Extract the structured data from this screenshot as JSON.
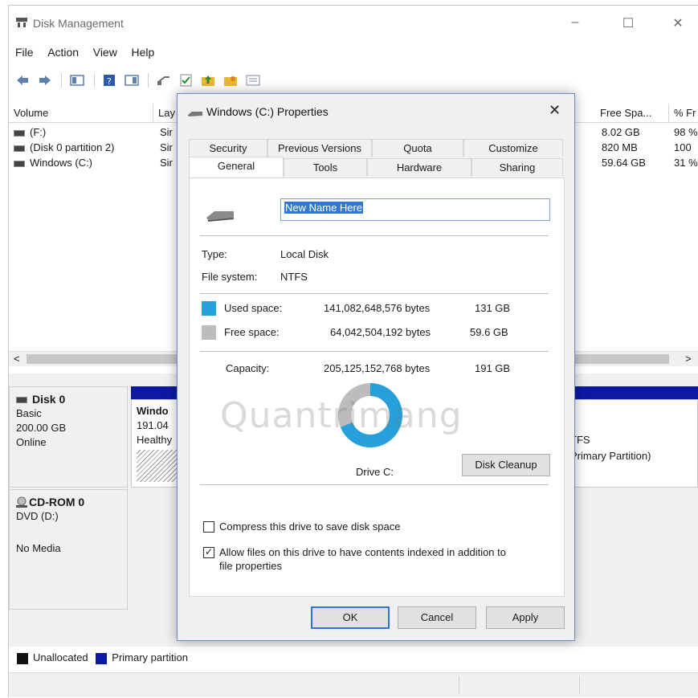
{
  "main": {
    "title": "Disk Management",
    "window_controls": {
      "minimize": "–",
      "maximize": "☐",
      "close": "✕"
    },
    "menu": [
      "File",
      "Action",
      "View",
      "Help"
    ],
    "columns": [
      "Volume",
      "Lay",
      "Free Spa...",
      "% Fr"
    ],
    "volumes": [
      {
        "name": "(F:)",
        "layout": "Sir",
        "free": "8.02 GB",
        "pct": "98 %"
      },
      {
        "name": "(Disk 0 partition 2)",
        "layout": "Sir",
        "free": "820 MB",
        "pct": "100"
      },
      {
        "name": "Windows (C:)",
        "layout": "Sir",
        "free": "59.64 GB",
        "pct": "31 %"
      }
    ],
    "scroll_left": "<",
    "scroll_right": ">",
    "disk0": {
      "name": "Disk 0",
      "type": "Basic",
      "size": "200.00 GB",
      "status": "Online"
    },
    "partition": {
      "name": "Windo",
      "size": "191.04",
      "health": "Healthy",
      "fs": "TFS",
      "kind": "Primary Partition)"
    },
    "cdrom": {
      "name": "CD-ROM 0",
      "drive": "DVD (D:)",
      "media": "No Media"
    },
    "legend": {
      "unallocated": "Unallocated",
      "primary": "Primary partition"
    },
    "colors": {
      "primary": "#0b1aa1",
      "unallocated": "#111111"
    }
  },
  "dialog": {
    "title": "Windows (C:) Properties",
    "close": "✕",
    "tabs_back": [
      "Security",
      "Previous Versions",
      "Quota",
      "Customize"
    ],
    "tabs_front": [
      "General",
      "Tools",
      "Hardware",
      "Sharing"
    ],
    "active_tab": "General",
    "name_value": "New Name Here",
    "type_label": "Type:",
    "type_value": "Local Disk",
    "fs_label": "File system:",
    "fs_value": "NTFS",
    "used_label": "Used space:",
    "used_bytes": "141,082,648,576 bytes",
    "used_gb": "131 GB",
    "free_label": "Free space:",
    "free_bytes": "64,042,504,192 bytes",
    "free_gb": "59.6 GB",
    "capacity_label": "Capacity:",
    "capacity_bytes": "205,125,152,768 bytes",
    "capacity_gb": "191 GB",
    "drive_label": "Drive C:",
    "cleanup_button": "Disk Cleanup",
    "compress_label": "Compress this drive to save disk space",
    "compress_checked": false,
    "index_label": "Allow files on this drive to have contents indexed in addition to",
    "index_label_2": "file properties",
    "index_checked": true,
    "ok": "OK",
    "cancel": "Cancel",
    "apply": "Apply",
    "used_fraction": 0.688,
    "colors": {
      "used": "#26a0da",
      "free": "#bcbcbc"
    }
  },
  "watermark": "Quantrimang"
}
